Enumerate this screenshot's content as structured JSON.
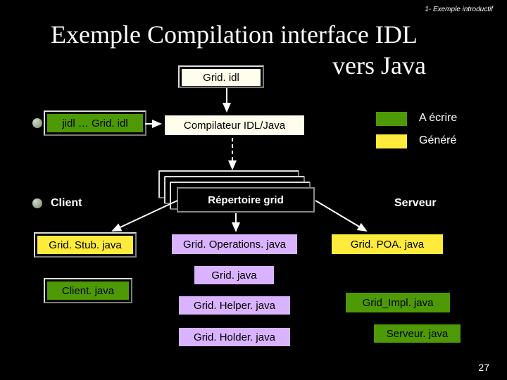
{
  "header": {
    "breadcrumb": "1- Exemple introductif"
  },
  "title": {
    "line1": "Exemple Compilation interface IDL",
    "line2": "vers Java"
  },
  "boxes": {
    "grid_idl": "Grid. idl",
    "jidl_cmd": "jidl … Grid. idl",
    "compiler": "Compilateur IDL/Java",
    "folder": "Répertoire grid",
    "stub": "Grid. Stub. java",
    "operations": "Grid. Operations. java",
    "poa": "Grid. POA. java",
    "grid_java": "Grid. java",
    "client_java": "Client. java",
    "helper": "Grid. Helper. java",
    "impl": "Grid_Impl. java",
    "holder": "Grid. Holder. java",
    "serveur_java": "Serveur. java"
  },
  "labels": {
    "client": "Client",
    "serveur": "Serveur"
  },
  "legend": {
    "a_ecrire": "A écrire",
    "genere": "Généré"
  },
  "colors": {
    "green": "#4e9a06",
    "yellow": "#ffeb3b",
    "pale_yellow": "#fffdeb",
    "purple": "#d9b3ff"
  },
  "page": "27"
}
